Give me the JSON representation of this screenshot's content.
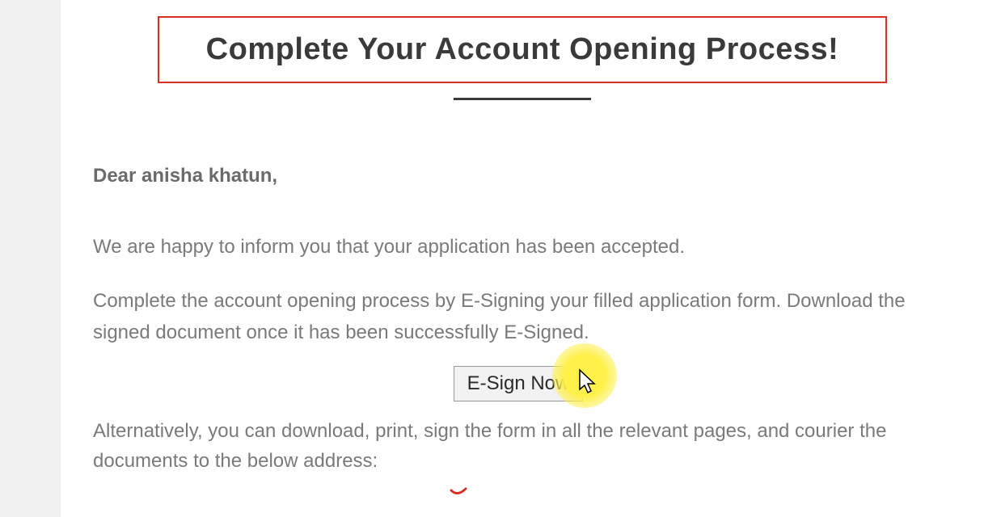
{
  "title": "Complete Your Account Opening Process!",
  "greeting": "Dear anisha khatun,",
  "paragraph1": "We are happy to inform you that your application has been accepted.",
  "paragraph2": "Complete the account opening process by E-Signing your filled application form. Download the signed document once it has been successfully E-Signed.",
  "button_label": "E-Sign Now",
  "paragraph3": "Alternatively, you can download, print, sign the form in all the relevant pages, and courier the documents to the below address:"
}
